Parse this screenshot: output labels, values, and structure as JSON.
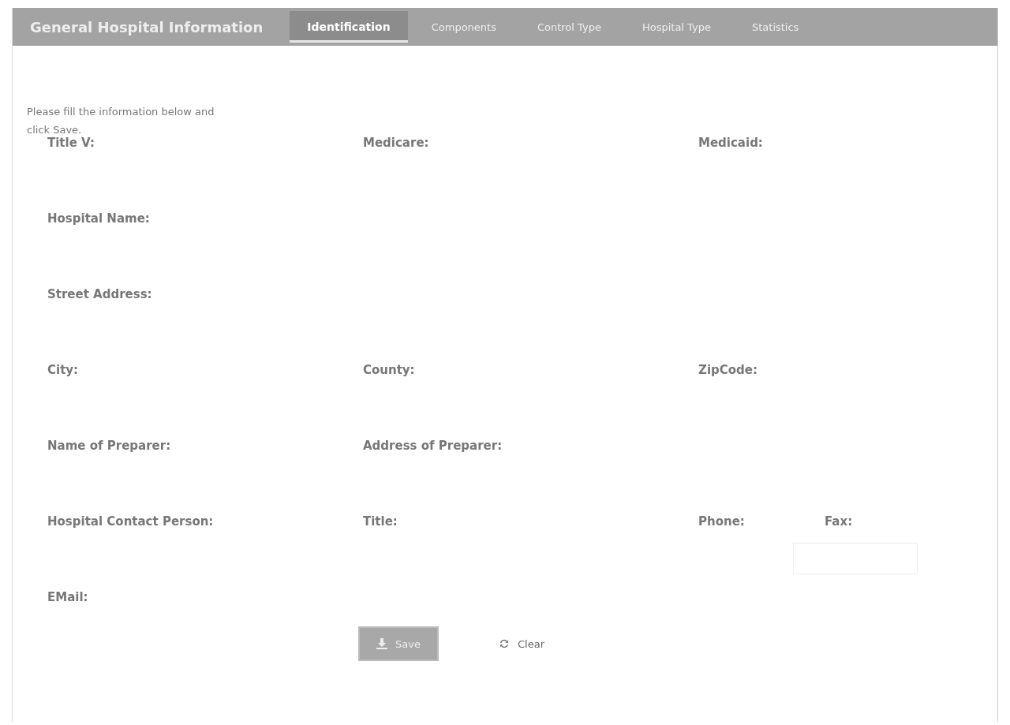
{
  "header": {
    "title": "General Hospital Information",
    "tabs": [
      {
        "label": "Identification",
        "selected": true
      },
      {
        "label": "Components",
        "selected": false
      },
      {
        "label": "Control Type",
        "selected": false
      },
      {
        "label": "Hospital Type",
        "selected": false
      },
      {
        "label": "Statistics",
        "selected": false
      }
    ]
  },
  "intro": "Please fill the information below and click Save.",
  "rows": [
    [
      {
        "label": "Title V:"
      },
      {
        "label": "Medicare:"
      },
      {
        "label": "Medicaid:"
      }
    ],
    [
      {
        "label": "Hospital Name:"
      }
    ],
    [
      {
        "label": "Street Address:"
      }
    ],
    [
      {
        "label": "City:"
      },
      {
        "label": "County:"
      },
      {
        "label": "ZipCode:"
      }
    ],
    [
      {
        "label": "Name of Preparer:"
      },
      {
        "label": "Address of Preparer:"
      }
    ],
    [
      {
        "label": "Hospital Contact Person:"
      },
      {
        "label": "Title:"
      },
      {
        "label": "Phone:"
      },
      {
        "label": "Fax:",
        "field": true
      }
    ],
    [
      {
        "label": "EMail:"
      }
    ]
  ],
  "buttons": [
    {
      "label": "Save",
      "kind": "save"
    },
    {
      "label": "Clear",
      "kind": "clear"
    }
  ]
}
